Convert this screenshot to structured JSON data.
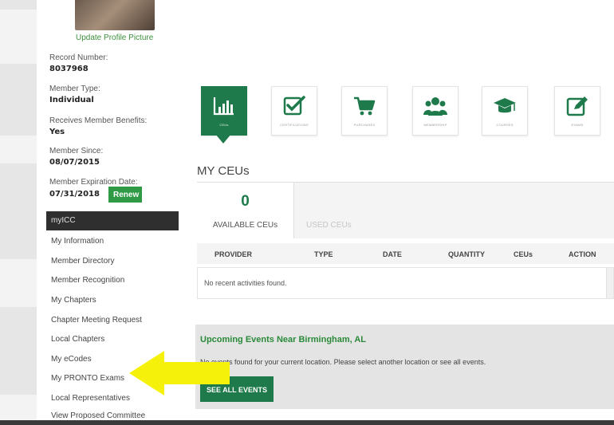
{
  "profile": {
    "update_link": "Update Profile Picture",
    "record_number_label": "Record Number:",
    "record_number": "8037968",
    "member_type_label": "Member Type:",
    "member_type": "Individual",
    "benefits_label": "Receives Member Benefits:",
    "benefits": "Yes",
    "member_since_label": "Member Since:",
    "member_since": "08/07/2015",
    "expiration_label": "Member Expiration Date:",
    "expiration": "07/31/2018",
    "renew_label": "Renew"
  },
  "sidebar": {
    "title": "myICC",
    "items": [
      {
        "label": "My Information"
      },
      {
        "label": "Member Directory"
      },
      {
        "label": "Member Recognition"
      },
      {
        "label": "My Chapters"
      },
      {
        "label": "Chapter Meeting Request"
      },
      {
        "label": "Local Chapters"
      },
      {
        "label": "My eCodes"
      },
      {
        "label": "My PRONTO Exams"
      },
      {
        "label": "Local Representatives"
      },
      {
        "label": "View Proposed Committee"
      }
    ]
  },
  "tiles": [
    {
      "label": "CEUs",
      "icon": "bar-chart-icon",
      "active": true
    },
    {
      "label": "CERTIFICATIONS",
      "icon": "checkbox-icon"
    },
    {
      "label": "PURCHASES",
      "icon": "cart-icon"
    },
    {
      "label": "MEMBERSHIP",
      "icon": "group-icon"
    },
    {
      "label": "COURSES",
      "icon": "graduation-cap-icon"
    },
    {
      "label": "EXAMS",
      "icon": "edit-icon"
    }
  ],
  "ceus": {
    "heading": "MY CEUs",
    "available_count": "0",
    "tab_available": "AVAILABLE CEUs",
    "tab_used": "USED CEUs",
    "columns": [
      "PROVIDER",
      "TYPE",
      "DATE",
      "QUANTITY",
      "CEUs",
      "ACTION"
    ],
    "empty_message": "No recent activities found."
  },
  "events": {
    "title": "Upcoming Events Near Birmingham, AL",
    "message": "No events found for your current location. Please select another location or see all events.",
    "button": "SEE ALL EVENTS"
  },
  "colors": {
    "brand_green": "#1e7a4a",
    "link_green": "#3c8f3c",
    "arrow_yellow": "#f5f10a"
  }
}
